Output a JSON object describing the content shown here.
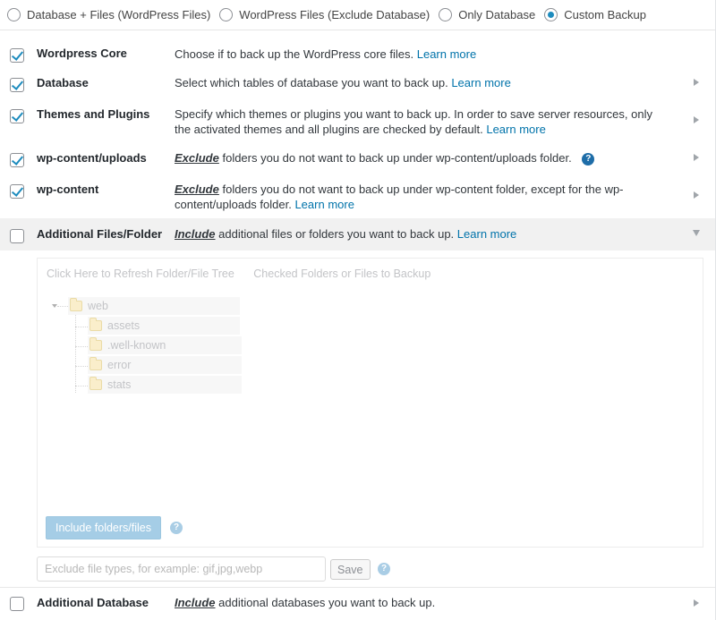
{
  "backup_type": {
    "options": [
      {
        "label": "Database + Files (WordPress Files)",
        "checked": false
      },
      {
        "label": "WordPress Files (Exclude Database)",
        "checked": false
      },
      {
        "label": "Only Database",
        "checked": false
      },
      {
        "label": "Custom Backup",
        "checked": true
      }
    ]
  },
  "rows": {
    "core": {
      "title": "Wordpress Core",
      "checked": true,
      "desc": "Choose if to back up the WordPress core files.",
      "link": "Learn more"
    },
    "database": {
      "title": "Database",
      "checked": true,
      "desc": "Select which tables of database you want to back up.",
      "link": "Learn more"
    },
    "themes": {
      "title": "Themes and Plugins",
      "checked": true,
      "desc": "Specify which themes or plugins you want to back up. In order to save server resources, only the activated themes and all plugins are checked by default.",
      "link": "Learn more"
    },
    "uploads": {
      "title": "wp-content/uploads",
      "checked": true,
      "em": "Exclude",
      "desc": " folders you do not want to back up under wp-content/uploads folder.",
      "help": "?"
    },
    "content": {
      "title": "wp-content",
      "checked": true,
      "em": "Exclude",
      "desc": " folders you do not want to back up under wp-content folder, except for the wp-content/uploads folder.",
      "link": "Learn more"
    },
    "additional_files": {
      "title": "Additional Files/Folder",
      "checked": false,
      "em": "Include",
      "desc": " additional files or folders you want to back up.",
      "link": "Learn more"
    },
    "additional_db": {
      "title": "Additional Database",
      "checked": false,
      "em": "Include",
      "desc": " additional databases you want to back up."
    }
  },
  "panel": {
    "refresh_tree": "Click Here to Refresh Folder/File Tree",
    "checked_label": "Checked Folders or Files to Backup",
    "tree": {
      "root": "web",
      "children": [
        "assets",
        ".well-known",
        "error",
        "stats"
      ]
    },
    "include_button": "Include folders/files",
    "help": "?"
  },
  "exclude": {
    "placeholder": "Exclude file types, for example: gif,jpg,webp",
    "save_button": "Save",
    "help": "?"
  }
}
